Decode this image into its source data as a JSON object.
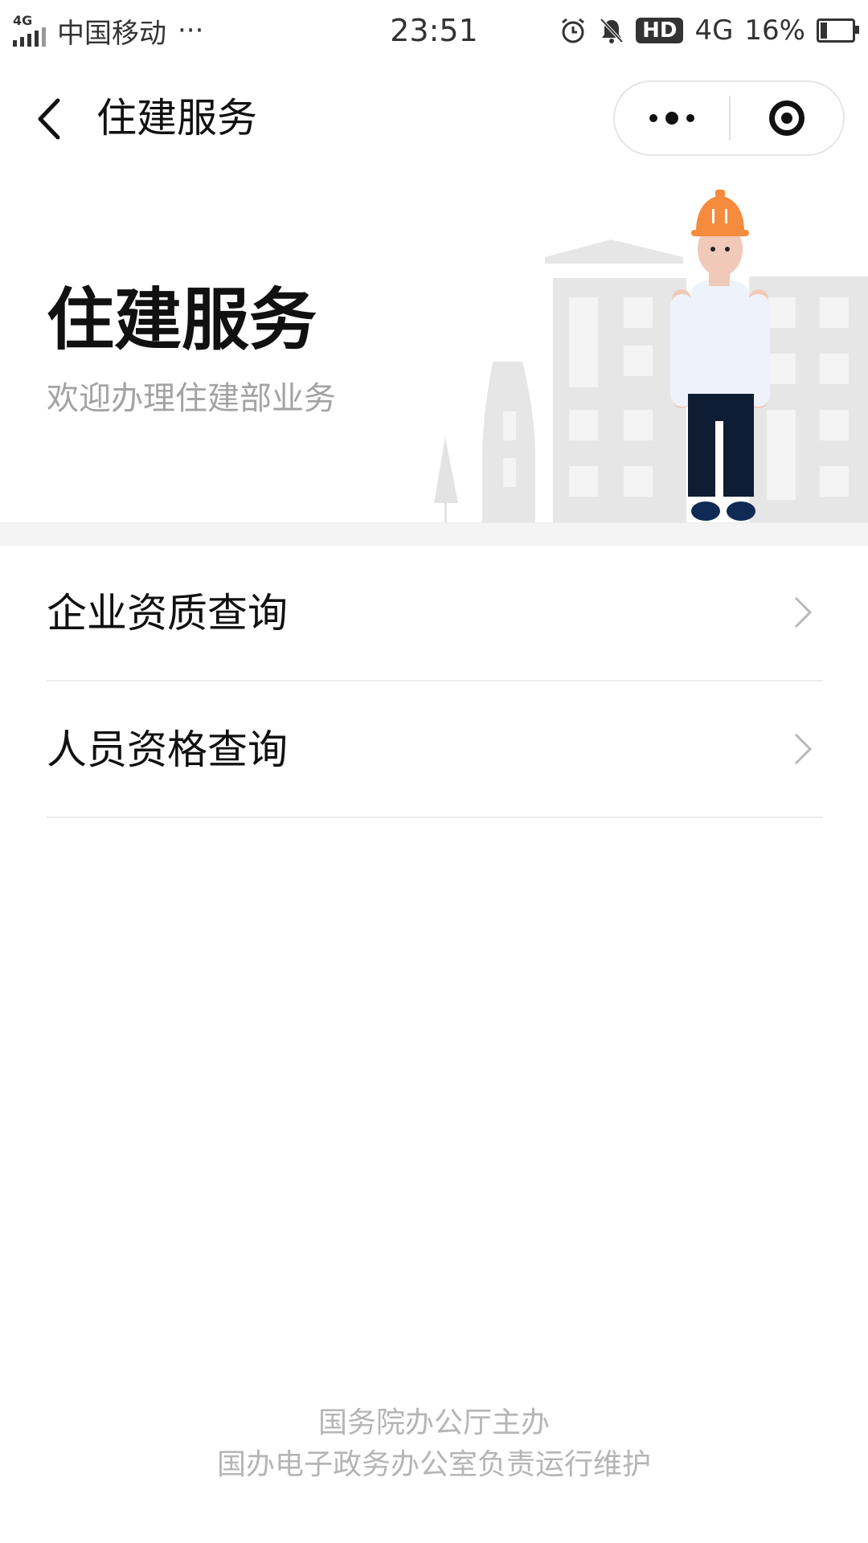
{
  "status_bar": {
    "network": "4G",
    "carrier": "中国移动",
    "more": "···",
    "time": "23:51",
    "hd": "HD",
    "data": "4G",
    "battery": "16%"
  },
  "nav": {
    "title": "住建服务"
  },
  "hero": {
    "title": "住建服务",
    "subtitle": "欢迎办理住建部业务"
  },
  "menu": {
    "items": [
      {
        "label": "企业资质查询"
      },
      {
        "label": "人员资格查询"
      }
    ]
  },
  "footer": {
    "line1": "国务院办公厅主办",
    "line2": "国办电子政务办公室负责运行维护"
  },
  "colors": {
    "helmet": "#f58b3c",
    "shirt": "#eef3fb",
    "pants": "#0f1d33",
    "building": "#e6e6e6",
    "muted_text": "#a3a3a3"
  }
}
